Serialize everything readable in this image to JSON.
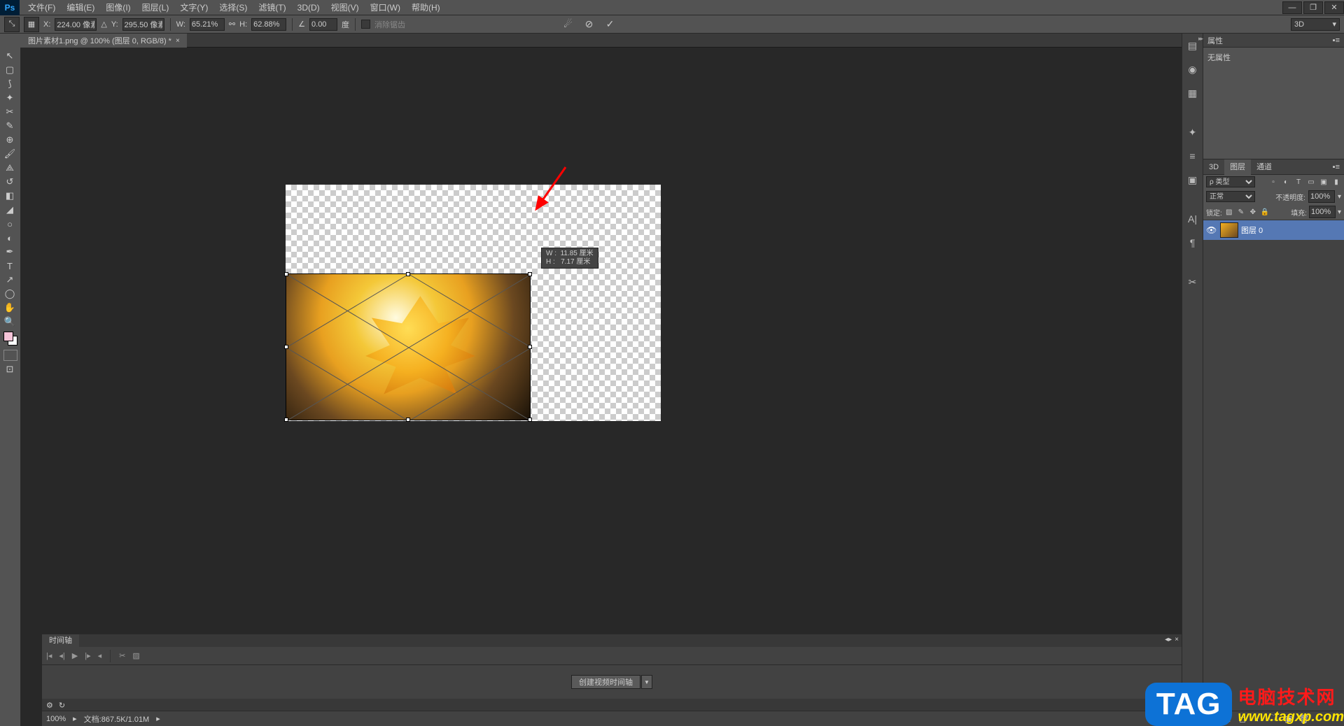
{
  "menu": {
    "file": "文件(F)",
    "edit": "编辑(E)",
    "image": "图像(I)",
    "layer": "图层(L)",
    "type": "文字(Y)",
    "select": "选择(S)",
    "filter": "滤镜(T)",
    "threeD": "3D(D)",
    "view": "视图(V)",
    "window": "窗口(W)",
    "help": "帮助(H)"
  },
  "options": {
    "x_label": "X:",
    "x_value": "224.00 像素",
    "y_label": "Y:",
    "y_value": "295.50 像素",
    "w_label": "W:",
    "w_value": "65.21%",
    "h_label": "H:",
    "h_value": "62.88%",
    "angle_icon": "∠",
    "angle_value": "0.00",
    "angle_unit": "度",
    "antialias": "消除锯齿",
    "mode_3d": "3D"
  },
  "tab": {
    "title": "图片素材1.png @ 100% (图层 0, RGB/8) *"
  },
  "tooltip": {
    "w_label": "W :",
    "w_value": "11.85 厘米",
    "h_label": "H :",
    "h_value": "7.17 厘米"
  },
  "panels": {
    "properties_title": "属性",
    "no_props": "无属性",
    "tab_3d": "3D",
    "tab_layers": "图层",
    "tab_channels": "通道",
    "filter_label": "ρ 类型",
    "blend_normal": "正常",
    "opacity_label": "不透明度:",
    "opacity_value": "100%",
    "lock_label": "锁定:",
    "fill_label": "填充:",
    "fill_value": "100%",
    "layer0": "图层 0"
  },
  "timeline": {
    "title": "时间轴",
    "create_btn": "创建视频时间轴"
  },
  "status": {
    "zoom": "100%",
    "doc": "文档:867.5K/1.01M"
  },
  "watermark": {
    "tag": "TAG",
    "cn": "电脑技术网",
    "url": "www.tagxp.com"
  }
}
